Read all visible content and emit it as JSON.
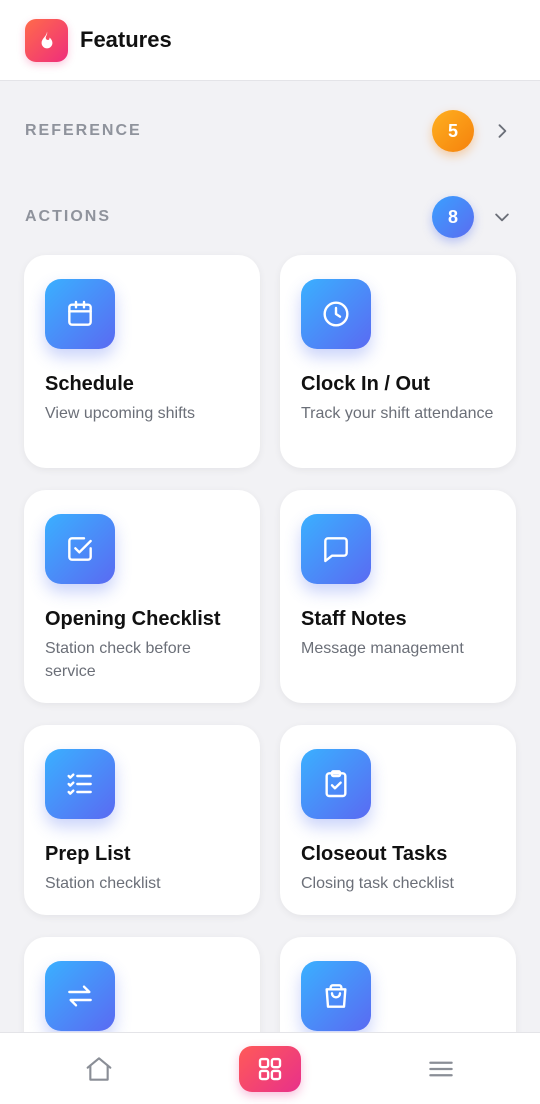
{
  "app": {
    "title": "Features",
    "logo_icon": "flame-icon",
    "accent": "#ef2d7c"
  },
  "sections": {
    "reference": {
      "title": "REFERENCE",
      "count": "5",
      "badge_color": "#f5810c",
      "expanded": false
    },
    "actions": {
      "title": "ACTIONS",
      "count": "8",
      "badge_color": "#5b6cf0",
      "expanded": true
    }
  },
  "cards": [
    {
      "title": "Schedule",
      "description": "View upcoming shifts",
      "icon": "calendar-icon"
    },
    {
      "title": "Clock In / Out",
      "description": "Track your shift attendance",
      "icon": "clock-icon"
    },
    {
      "title": "Opening Checklist",
      "description": "Station check before service",
      "icon": "checkbox-icon"
    },
    {
      "title": "Staff Notes",
      "description": "Message management",
      "icon": "message-icon"
    },
    {
      "title": "Prep List",
      "description": "Station checklist",
      "icon": "list-icon"
    },
    {
      "title": "Closeout Tasks",
      "description": "Closing task checklist",
      "icon": "clipboard-check-icon"
    },
    {
      "title": "",
      "description": "",
      "icon": "swap-icon"
    },
    {
      "title": "",
      "description": "",
      "icon": "shopping-bag-icon"
    }
  ],
  "tabbar": {
    "items": [
      {
        "name": "home",
        "icon": "home-icon",
        "active": false
      },
      {
        "name": "features",
        "icon": "grid-icon",
        "active": true
      },
      {
        "name": "menu",
        "icon": "menu-icon",
        "active": false
      }
    ]
  }
}
